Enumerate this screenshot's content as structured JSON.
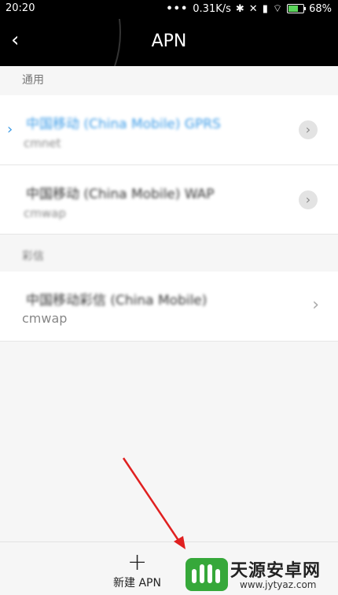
{
  "status_bar": {
    "time": "20:20",
    "dots": "•••",
    "network_speed": "0.31K/s",
    "battery_percent": "68%",
    "battery_level": 0.68
  },
  "header": {
    "title": "APN",
    "back_icon": "back-arrow-icon"
  },
  "sections": {
    "general": {
      "label": "通用"
    },
    "mms": {
      "label": "彩信"
    }
  },
  "apn_rows": [
    {
      "name": "中国移动 (China Mobile) GPRS",
      "type": "cmnet",
      "selected": true
    },
    {
      "name": "中国移动 (China Mobile) WAP",
      "type": "cmwap",
      "selected": false
    },
    {
      "name": "中国移动彩信 (China Mobile)",
      "type": "cmwap",
      "selected": false
    }
  ],
  "bottom": {
    "add_label": "新建 APN",
    "add_icon": "plus-icon"
  },
  "watermark": {
    "title": "天源安卓网",
    "url": "www.jytyaz.com"
  },
  "colors": {
    "accent": "#3b9be7",
    "arrow": "#e02020",
    "logo_green": "#36a83a"
  }
}
